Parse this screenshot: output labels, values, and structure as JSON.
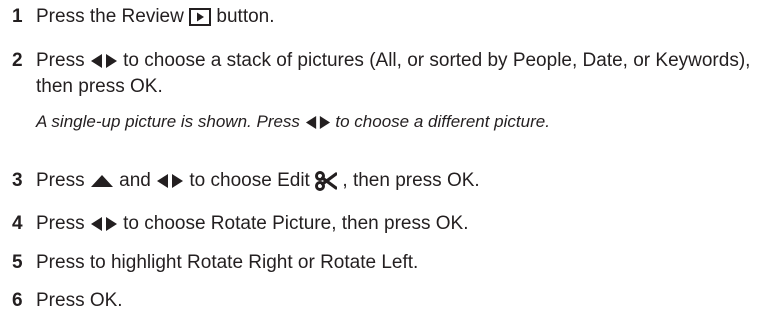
{
  "steps": [
    {
      "number": "1",
      "parts": [
        "Press the Review",
        "button."
      ]
    },
    {
      "number": "2",
      "parts": [
        "Press",
        "to choose a stack of pictures (All, or sorted by People, Date, or Keywords), then press OK."
      ],
      "note_parts": [
        "A single-up picture is shown. Press",
        "to choose a different picture."
      ]
    },
    {
      "number": "3",
      "parts": [
        "Press",
        "and",
        "to choose Edit",
        ", then press OK."
      ]
    },
    {
      "number": "4",
      "parts": [
        "Press",
        "to choose Rotate Picture, then press OK."
      ]
    },
    {
      "number": "5",
      "parts": [
        "Press to highlight Rotate Right or Rotate Left."
      ]
    },
    {
      "number": "6",
      "parts": [
        "Press OK."
      ]
    }
  ],
  "icons": {
    "review": "review-button-icon",
    "left_right": "left-right-arrows-icon",
    "up": "up-arrow-icon",
    "edit": "edit-scissors-icon"
  },
  "colors": {
    "text": "#231f20"
  }
}
